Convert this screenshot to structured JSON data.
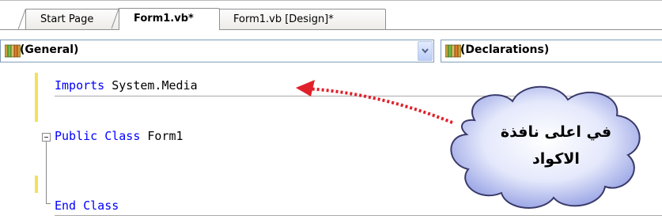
{
  "tabs": [
    {
      "label": "Start Page",
      "active": false
    },
    {
      "label": "Form1.vb*",
      "active": true
    },
    {
      "label": "Form1.vb [Design]*",
      "active": false
    }
  ],
  "combos": {
    "left": {
      "label": "(General)"
    },
    "right": {
      "label": "(Declarations)"
    }
  },
  "code": {
    "line1": {
      "kw": "Imports",
      "rest": " System.Media"
    },
    "line2": {
      "kw1": "Public",
      "kw2": "Class",
      "rest": " Form1"
    },
    "line3": {
      "kw1": "End",
      "kw2": "Class"
    }
  },
  "annotation": {
    "line1": "في اعلى نافذة",
    "line2": "الاكواد"
  },
  "colors": {
    "keyword": "#0000ff",
    "arrow": "#e0202a",
    "cloud": "#9aa7e8"
  }
}
